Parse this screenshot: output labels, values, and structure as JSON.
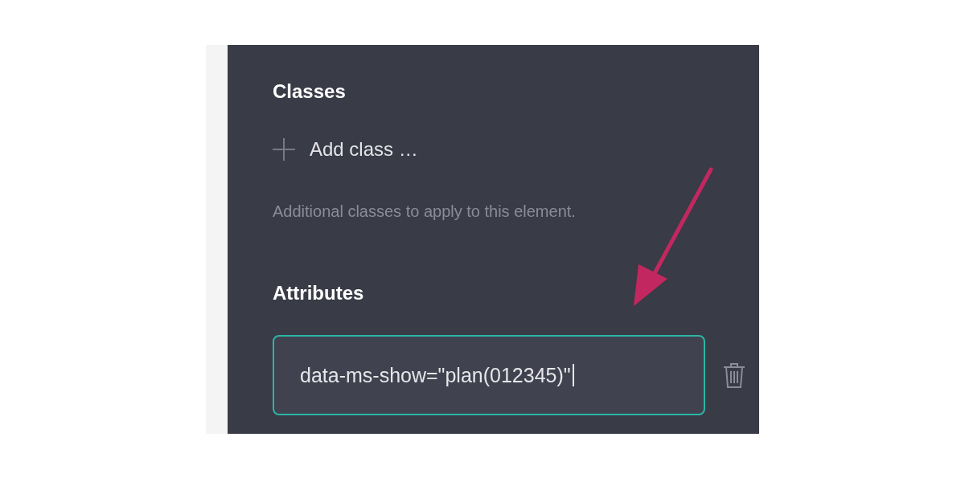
{
  "sections": [
    {
      "kind": "classes",
      "heading": "Classes",
      "add_label": "Add class …",
      "help": "Additional classes to apply to this element."
    },
    {
      "kind": "attributes",
      "heading": "Attributes",
      "value": "data-ms-show=\"plan(012345)\""
    }
  ]
}
